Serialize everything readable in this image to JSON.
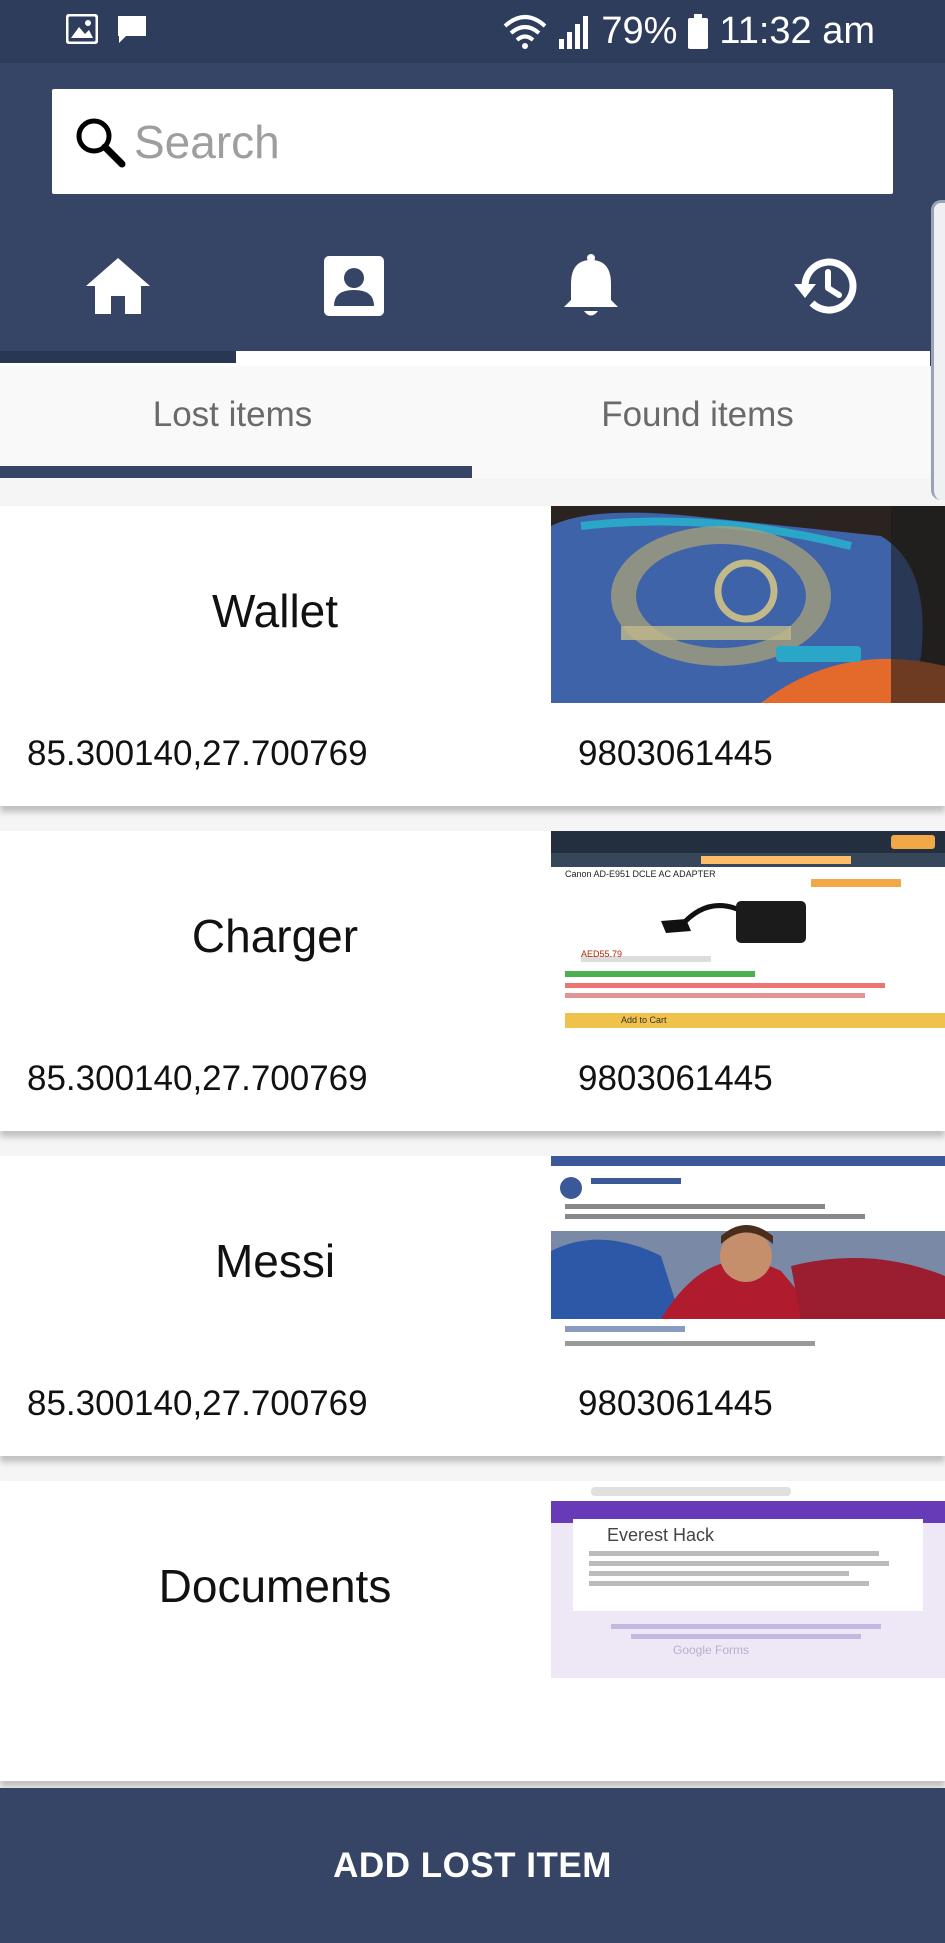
{
  "status_bar": {
    "battery": "79%",
    "time": "11:32 am",
    "icons": [
      "image-icon",
      "message-icon",
      "wifi-icon",
      "signal-icon",
      "battery-icon"
    ]
  },
  "search": {
    "placeholder": "Search",
    "value": ""
  },
  "nav_tabs": [
    {
      "icon": "home-icon",
      "selected": true
    },
    {
      "icon": "contact-icon",
      "selected": false
    },
    {
      "icon": "bell-icon",
      "selected": false
    },
    {
      "icon": "history-icon",
      "selected": false
    }
  ],
  "sub_tabs": [
    {
      "label": "Lost items",
      "selected": true
    },
    {
      "label": "Found items",
      "selected": false
    }
  ],
  "items": [
    {
      "title": "Wallet",
      "coords": "85.300140,27.700769",
      "phone": "9803061445",
      "image": "backpack-photo"
    },
    {
      "title": "Charger",
      "coords": "85.300140,27.700769",
      "phone": "9803061445",
      "image": "charger-screenshot"
    },
    {
      "title": "Messi",
      "coords": "85.300140,27.700769",
      "phone": "9803061445",
      "image": "messi-screenshot"
    },
    {
      "title": "Documents",
      "coords": "",
      "phone": "",
      "image": "form-screenshot"
    }
  ],
  "thumb_texts": {
    "charger_title": "Canon AD-E951 DCLE AC ADAPTER",
    "charger_price": "AED55.79",
    "charger_cta": "Add to Cart",
    "form_heading": "Everest Hack",
    "form_footer": "Google Forms"
  },
  "add_button": {
    "label": "ADD LOST ITEM"
  },
  "colors": {
    "primary": "#364566",
    "statusbar": "#2f3d5c",
    "indicator": "#2a3754"
  }
}
